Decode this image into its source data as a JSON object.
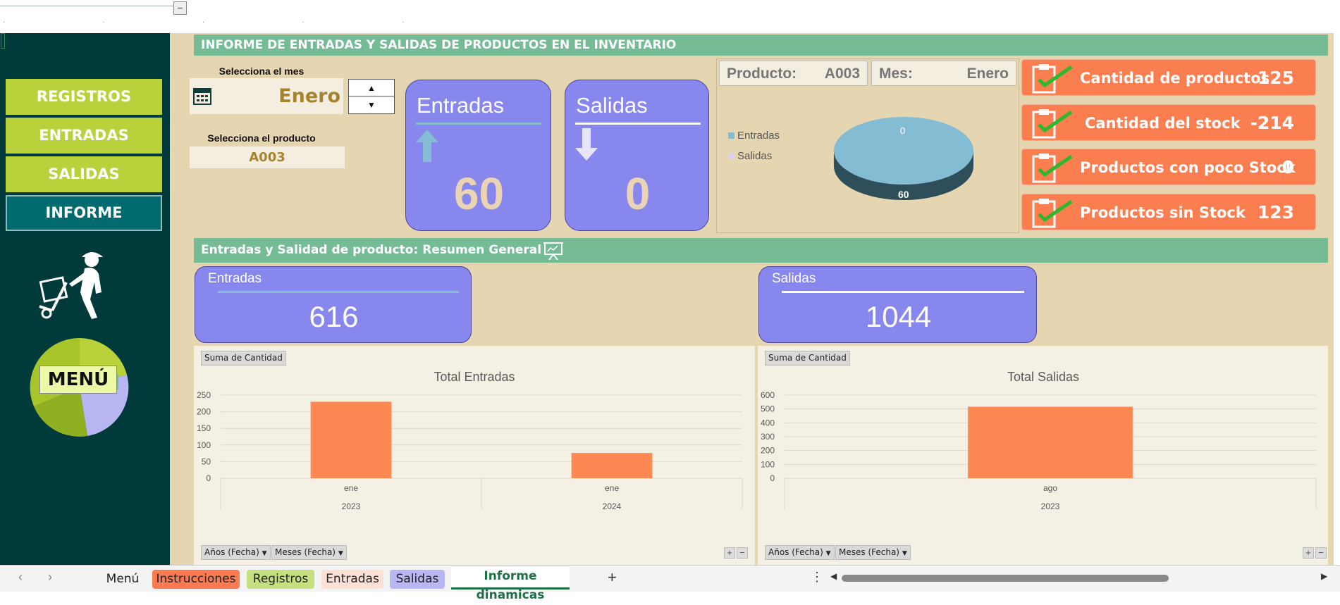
{
  "sidebar": {
    "nav": [
      {
        "label": "REGISTROS"
      },
      {
        "label": "ENTRADAS"
      },
      {
        "label": "SALIDAS"
      },
      {
        "label": "INFORME"
      }
    ],
    "menu_label": "MENÚ"
  },
  "header": {
    "title": "INFORME DE ENTRADAS Y SALIDAS DE PRODUCTOS EN EL INVENTARIO"
  },
  "controls": {
    "month_label": "Selecciona el mes",
    "month_value": "Enero",
    "product_label": "Selecciona el producto",
    "product_value": "A003"
  },
  "cards": {
    "entradas_title": "Entradas",
    "entradas_value": "60",
    "salidas_title": "Salidas",
    "salidas_value": "0"
  },
  "pie_panel": {
    "producto_label": "Producto:",
    "producto_value": "A003",
    "mes_label": "Mes:",
    "mes_value": "Enero",
    "legend": [
      "Entradas",
      "Salidas"
    ],
    "label_top": "0",
    "label_center": "60",
    "colors": {
      "entradas": "#84bcd4",
      "salidas": "#d9d2f0"
    }
  },
  "kpis": [
    {
      "label": "Cantidad de productos",
      "value": "125"
    },
    {
      "label": "Cantidad del stock",
      "value": "-214"
    },
    {
      "label": "Productos con poco Stock",
      "value": "0"
    },
    {
      "label": "Productos sin Stock",
      "value": "123"
    }
  ],
  "summary": {
    "title": "Entradas y Salidad de producto: Resumen General",
    "entradas_title": "Entradas",
    "entradas_value": "616",
    "salidas_title": "Salidas",
    "salidas_value": "1044"
  },
  "pivot": {
    "sum_button": "Suma de Cantidad",
    "years_button": "Años (Fecha)",
    "months_button": "Meses (Fecha)"
  },
  "chart_data": [
    {
      "type": "bar",
      "title": "Total Entradas",
      "categories": [
        "ene",
        "ene"
      ],
      "groups": [
        "2023",
        "2024"
      ],
      "values": [
        230,
        76
      ],
      "ylim": [
        0,
        250
      ],
      "yticks": [
        0,
        50,
        100,
        150,
        200,
        250
      ],
      "bar_color": "#fd8853",
      "grid": true
    },
    {
      "type": "bar",
      "title": "Total Salidas",
      "categories": [
        "ago"
      ],
      "groups": [
        "2023"
      ],
      "values": [
        516
      ],
      "ylim": [
        0,
        600
      ],
      "yticks": [
        0,
        100,
        200,
        300,
        400,
        500,
        600
      ],
      "bar_color": "#fd8853",
      "grid": true
    }
  ],
  "tabs": [
    {
      "label": "Menú",
      "color": "#f3f3f3"
    },
    {
      "label": "Instrucciones",
      "color": "#fc7a52"
    },
    {
      "label": "Registros",
      "color": "#c6e080"
    },
    {
      "label": "Entradas",
      "color": "#fde1d7"
    },
    {
      "label": "Salidas",
      "color": "#b9b7f3"
    },
    {
      "label": "Informe dinamicas",
      "color": "#ffffff"
    }
  ]
}
